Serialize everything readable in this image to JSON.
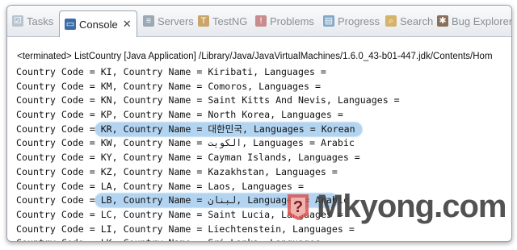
{
  "tabs": [
    {
      "label": "Tasks",
      "icon": "tasks-icon",
      "active": false
    },
    {
      "label": "Console",
      "icon": "console-icon",
      "active": true
    },
    {
      "label": "Servers",
      "icon": "servers-icon",
      "active": false
    },
    {
      "label": "TestNG",
      "icon": "testng-icon",
      "active": false
    },
    {
      "label": "Problems",
      "icon": "problems-icon",
      "active": false
    },
    {
      "label": "Progress",
      "icon": "progress-icon",
      "active": false
    },
    {
      "label": "Search",
      "icon": "search-icon",
      "active": false
    },
    {
      "label": "Bug Explorer",
      "icon": "bug-explorer-icon",
      "active": false
    }
  ],
  "console": {
    "header": "<terminated> ListCountry [Java Application] /Library/Java/JavaVirtualMachines/1.6.0_43-b01-447.jdk/Contents/Hom",
    "lines": [
      {
        "text": "Country Code = KI, Country Name = Kiribati, Languages =",
        "highlight": false
      },
      {
        "text": "Country Code = KM, Country Name = Comoros, Languages =",
        "highlight": false
      },
      {
        "text": "Country Code = KN, Country Name = Saint Kitts And Nevis, Languages =",
        "highlight": false
      },
      {
        "text": "Country Code = KP, Country Name = North Korea, Languages =",
        "highlight": false
      },
      {
        "text": "Country Code = KR, Country Name = 대한민국, Languages = Korean",
        "highlight": true
      },
      {
        "text": "Country Code = KW, Country Name = الكويت, Languages = Arabic",
        "highlight": false
      },
      {
        "text": "Country Code = KY, Country Name = Cayman Islands, Languages =",
        "highlight": false
      },
      {
        "text": "Country Code = KZ, Country Name = Kazakhstan, Languages =",
        "highlight": false
      },
      {
        "text": "Country Code = LA, Country Name = Laos, Languages =",
        "highlight": false
      },
      {
        "text": "Country Code = LB, Country Name = لبنان, Languages = Arabic",
        "highlight": true
      },
      {
        "text": "Country Code = LC, Country Name = Saint Lucia, Languages =",
        "highlight": false
      },
      {
        "text": "Country Code = LI, Country Name = Liechtenstein, Languages =",
        "highlight": false
      },
      {
        "text": "Country Code = LK, Country Name = Sri Lanka, Languages =",
        "highlight": false
      }
    ]
  },
  "watermark": {
    "text": "Mkyong.com",
    "brand_color": "#d9534f"
  }
}
